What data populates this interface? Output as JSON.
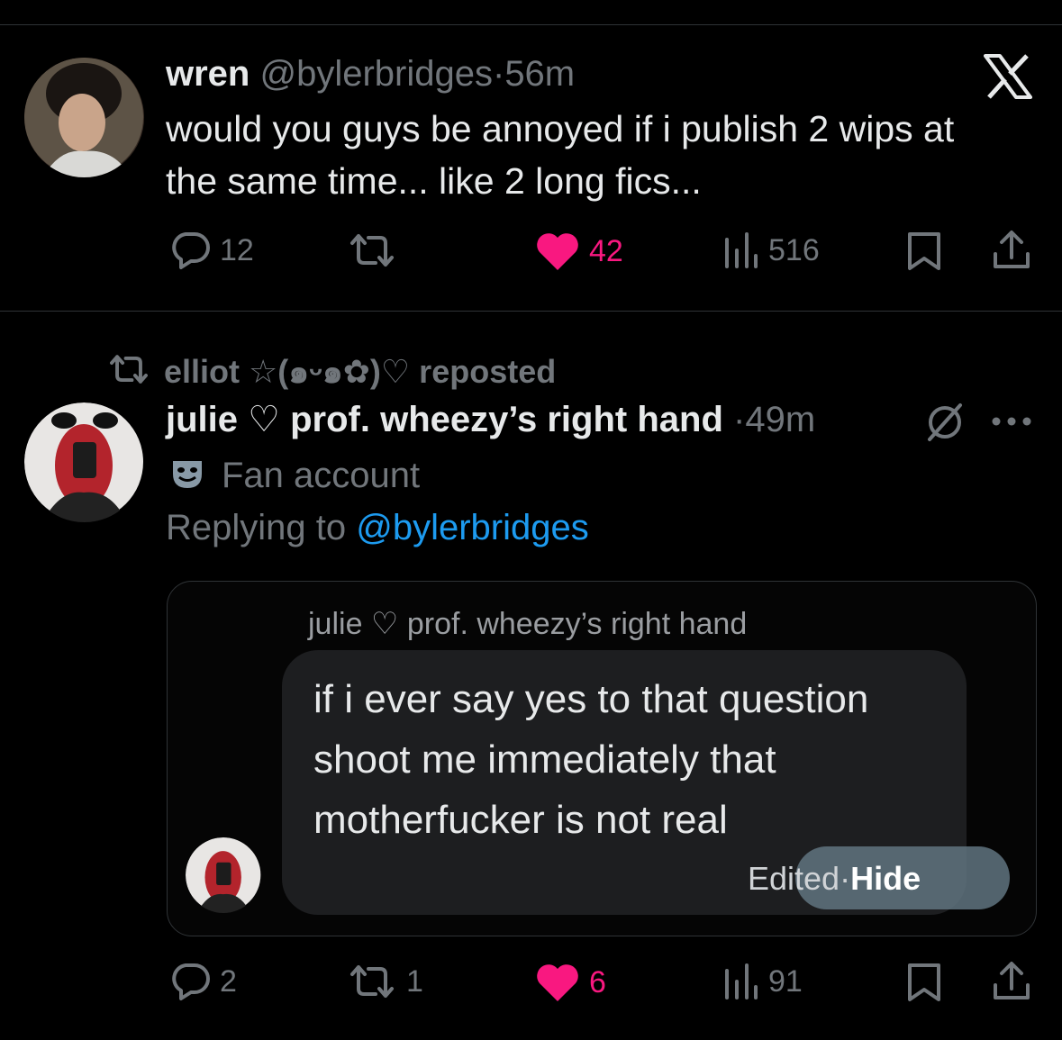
{
  "tweet1": {
    "display_name": "wren",
    "handle": "@bylerbridges",
    "dot": "·",
    "time": "56m",
    "text_line1": "would you guys be annoyed if i publish 2 wips at",
    "text_line2": "the same time... like 2 long fics...",
    "actions": {
      "replies": "12",
      "reposts": "",
      "likes": "42",
      "views": "516"
    }
  },
  "tweet2": {
    "repost_label": "elliot ☆(๑ᵕ๑✿)♡ reposted",
    "display_name": "julie ♡ prof. wheezy’s right hand",
    "dot": "·",
    "time": "49m",
    "affiliation": "Fan account",
    "replying_prefix": "Replying to",
    "replying_handle": "@bylerbridges",
    "quote": {
      "name": "julie ♡ prof. wheezy’s right hand",
      "line1": "if i ever say yes to that question",
      "line2": "shoot me immediately that",
      "line3": "motherfucker is not real",
      "edited": "Edited",
      "dot": "·",
      "hide": "Hide"
    },
    "actions": {
      "replies": "2",
      "reposts": "1",
      "likes": "6",
      "views": "91"
    }
  },
  "colors": {
    "like": "#f91880",
    "link": "#1d9bf0",
    "muted": "#71767b",
    "text": "#e7e9ea"
  }
}
